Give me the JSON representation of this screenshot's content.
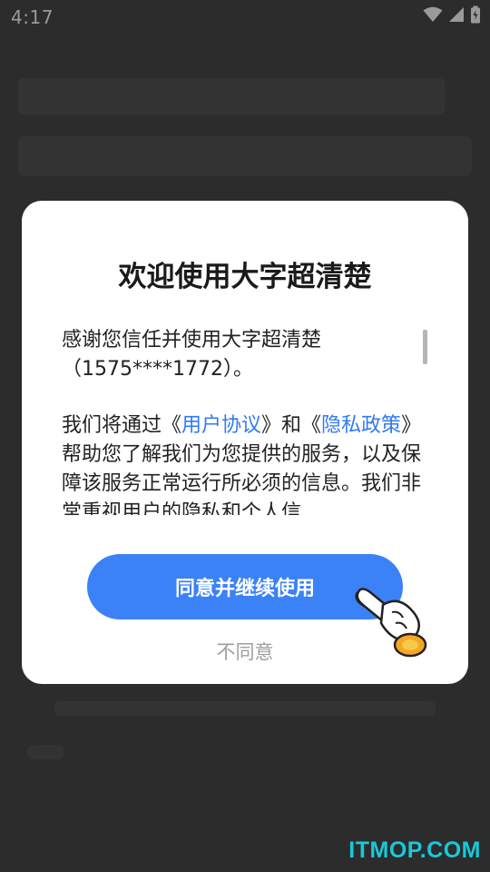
{
  "status_bar": {
    "time": "4:17",
    "icons": [
      "wifi-icon",
      "signal-icon",
      "battery-icon"
    ]
  },
  "dialog": {
    "title": "欢迎使用大字超清楚",
    "paragraph1": "感谢您信任并使用大字超清楚（1575****1772）。",
    "paragraph2": {
      "text_before": "我们将通过《",
      "link_user_agreement": "用户协议",
      "text_middle": "》和《",
      "link_privacy_policy": "隐私政策",
      "text_after": "》帮助您了解我们为您提供的服务，以及保障该服务正常运行所必须的信息。我们非常重视用户的隐私和个人信"
    },
    "agree_button": "同意并继续使用",
    "disagree_button": "不同意"
  },
  "watermark": "ITMOP.COM",
  "colors": {
    "accent": "#3b82f6",
    "link": "#2f7bf5",
    "overlay": "#2c2c2c",
    "watermark": "#18c8d8"
  }
}
